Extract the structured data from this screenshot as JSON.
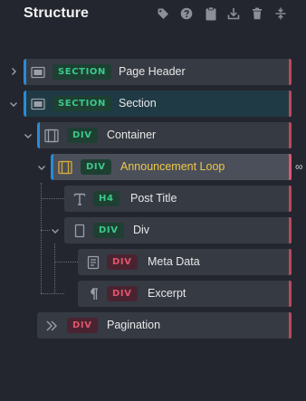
{
  "panel": {
    "title": "Structure",
    "tools": [
      "tag-icon",
      "help-icon",
      "clipboard-icon",
      "download-icon",
      "trash-icon",
      "collapse-icon"
    ]
  },
  "tree": [
    {
      "id": "page-header",
      "badge": "SECTION",
      "label": "Page Header",
      "expanded": false,
      "badge_color": "green"
    },
    {
      "id": "section",
      "badge": "SECTION",
      "label": "Section",
      "expanded": true,
      "badge_color": "green"
    },
    {
      "id": "container",
      "badge": "DIV",
      "label": "Container",
      "expanded": true,
      "badge_color": "green"
    },
    {
      "id": "announcement-loop",
      "badge": "DIV",
      "label": "Announcement Loop",
      "expanded": true,
      "badge_color": "green",
      "selected": true
    },
    {
      "id": "post-title",
      "badge": "H4",
      "label": "Post Title",
      "badge_color": "green"
    },
    {
      "id": "div",
      "badge": "DIV",
      "label": "Div",
      "expanded": true,
      "badge_color": "green"
    },
    {
      "id": "meta-data",
      "badge": "DIV",
      "label": "Meta Data",
      "badge_color": "red"
    },
    {
      "id": "excerpt",
      "badge": "DIV",
      "label": "Excerpt",
      "badge_color": "red"
    },
    {
      "id": "pagination",
      "badge": "DIV",
      "label": "Pagination",
      "badge_color": "red"
    }
  ],
  "loop_marker": "∞",
  "colors": {
    "background": "#23262e",
    "row": "#363a43",
    "row_selected": "#4a4f59",
    "accent_blue": "#2a8bd6",
    "accent_red": "#b74a5b",
    "badge_green": "#3cc98a",
    "badge_red": "#e0566e",
    "highlight_text": "#f0c84b"
  }
}
